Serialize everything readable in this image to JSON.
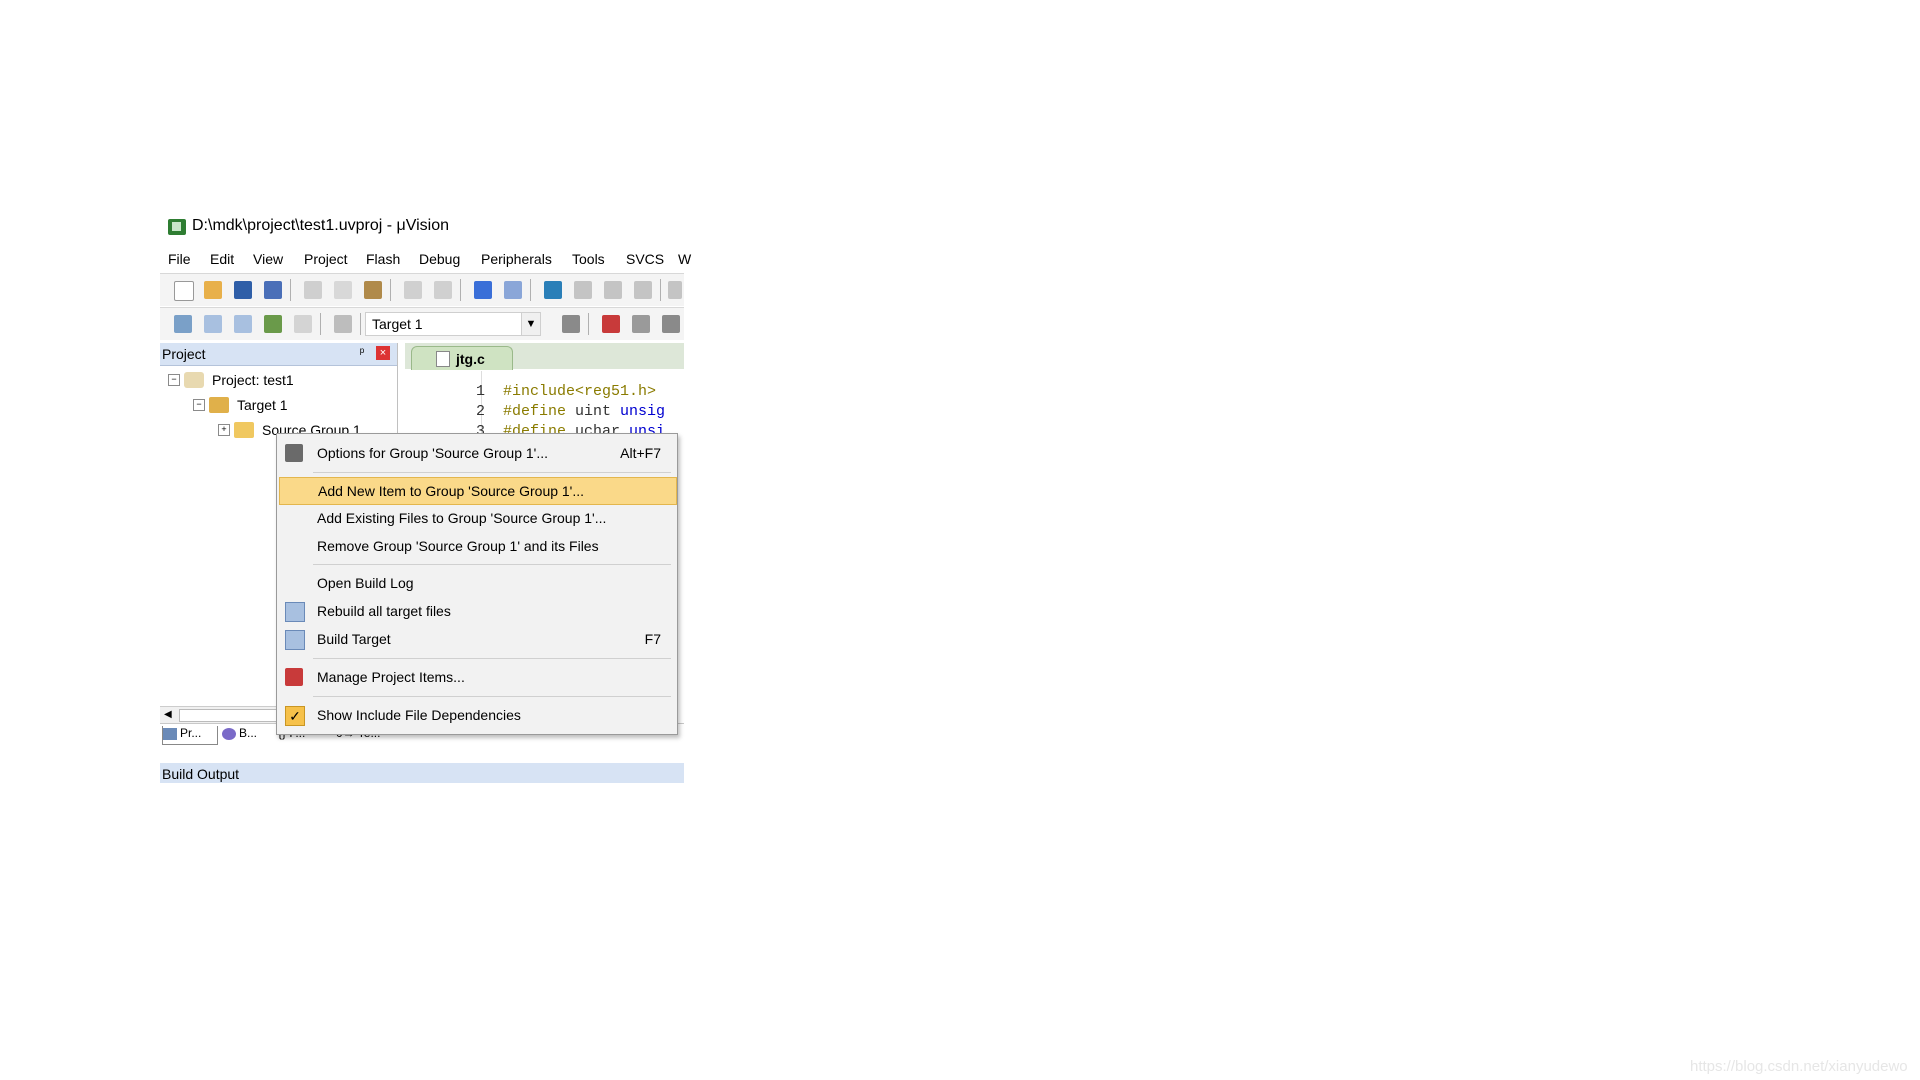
{
  "window": {
    "title": "D:\\mdk\\project\\test1.uvproj - μVision"
  },
  "menu": [
    "File",
    "Edit",
    "View",
    "Project",
    "Flash",
    "Debug",
    "Peripherals",
    "Tools",
    "SVCS",
    "W"
  ],
  "toolbar": {
    "target_value": "Target 1"
  },
  "project_panel": {
    "title": "Project",
    "pin": "ᵖ",
    "close": "×",
    "tree": [
      {
        "label": "Project: test1",
        "expander": "−"
      },
      {
        "label": "Target 1",
        "expander": "−"
      },
      {
        "label": "Source Group 1",
        "expander": "+"
      }
    ]
  },
  "editor": {
    "tab_label": "jtg.c",
    "lines": [
      {
        "n": "1",
        "a": "#include<reg51.h>",
        "b": "",
        "c": ""
      },
      {
        "n": "2",
        "a": "#define",
        "b": " uint ",
        "c": "unsig"
      },
      {
        "n": "3",
        "a": "#define",
        "b": " uchar ",
        "c": "unsi"
      }
    ]
  },
  "context_menu": {
    "items": [
      {
        "label": "Options for Group 'Source Group 1'...",
        "shortcut": "Alt+F7",
        "icon": "options-wand-icon"
      },
      {
        "label": "Add New  Item to Group 'Source Group 1'...",
        "shortcut": "",
        "icon": ""
      },
      {
        "label": "Add Existing Files to Group 'Source Group 1'...",
        "shortcut": "",
        "icon": ""
      },
      {
        "label": "Remove Group 'Source Group 1' and its Files",
        "shortcut": "",
        "icon": ""
      },
      {
        "label": "Open Build Log",
        "shortcut": "",
        "icon": ""
      },
      {
        "label": "Rebuild all target files",
        "shortcut": "",
        "icon": "rebuild-icon"
      },
      {
        "label": "Build Target",
        "shortcut": "F7",
        "icon": "build-icon"
      },
      {
        "label": "Manage Project Items...",
        "shortcut": "",
        "icon": "manage-items-icon"
      },
      {
        "label": "Show Include File Dependencies",
        "shortcut": "",
        "icon": "checkmark-icon"
      }
    ],
    "checkmark": "✓"
  },
  "bottom_tabs": [
    "Pr...",
    "B...",
    "{} F...",
    "0→ Te..."
  ],
  "build_output": {
    "title": "Build Output"
  },
  "watermark": "https://blog.csdn.net/xianyudewo"
}
